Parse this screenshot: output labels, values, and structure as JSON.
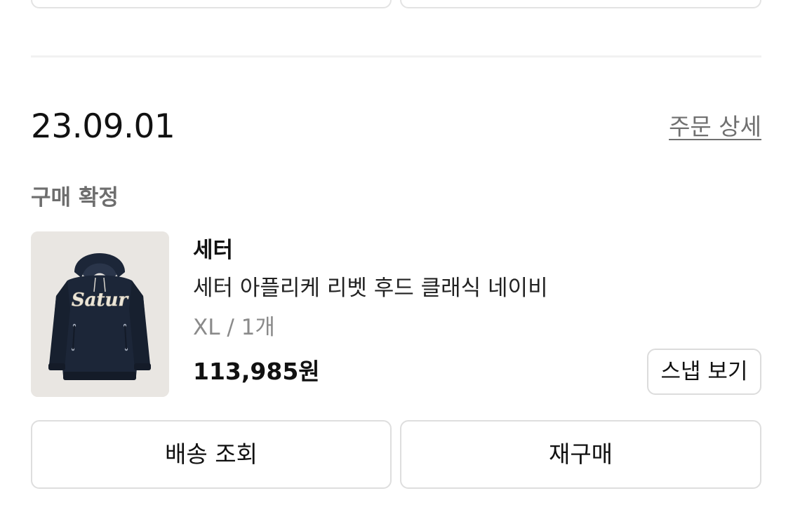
{
  "order": {
    "date": "23.09.01",
    "detail_link": "주문 상세",
    "status": "구매 확정",
    "item": {
      "brand": "세터",
      "name": "세터 아플리케 리벳 후드 클래식 네이비",
      "option": "XL / 1개",
      "price": "113,985원",
      "snap_button": "스냅 보기",
      "thumbnail_text": "Satur",
      "thumbnail_icon": "navy-hoodie-image"
    },
    "actions": {
      "track_delivery": "배송 조회",
      "reorder": "재구매"
    }
  },
  "colors": {
    "hoodie_navy": "#1c2638",
    "thumb_bg": "#e9e6e2",
    "muted_text": "#707070",
    "border": "#dedede"
  }
}
